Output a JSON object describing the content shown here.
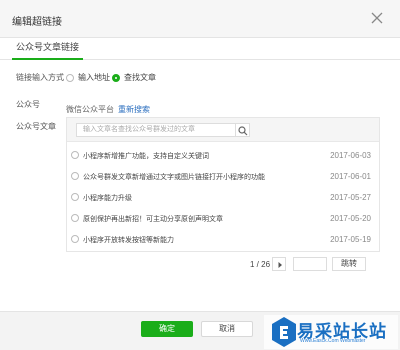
{
  "dialog": {
    "title": "编辑超链接",
    "tab_label": "公众号文章链接",
    "link_input_label": "链接输入方式",
    "option_address": "输入地址",
    "option_search": "查找文章",
    "selected_option": "查找文章",
    "account_label": "公众号",
    "account_name": "微信公众平台",
    "reselect_link": "重新搜索",
    "article_label": "公众号文章",
    "search_placeholder": "输入文章名查找公众号群发过的文章",
    "articles": [
      {
        "title": "小程序新增推广功能，支持自定义关键词",
        "date": "2017-06-03"
      },
      {
        "title": "公众号群发文章新增通过文字或图片链接打开小程序的功能",
        "date": "2017-06-01"
      },
      {
        "title": "小程序能力升级",
        "date": "2017-05-27"
      },
      {
        "title": "原创保护再出新招！可主动分享原创声明文章",
        "date": "2017-05-20"
      },
      {
        "title": "小程序开放转发按钮等新能力",
        "date": "2017-05-19"
      }
    ],
    "pagination": {
      "text": "1 / 26",
      "jump_label": "跳转"
    },
    "confirm_label": "确定",
    "cancel_label": "取消"
  },
  "watermark": {
    "main": "易采站长站",
    "sub": "Www.Easck.Com Webmaster"
  },
  "colors": {
    "accent": "#1aad19",
    "link": "#2c6fbf",
    "watermark": "#1a6fc2"
  }
}
